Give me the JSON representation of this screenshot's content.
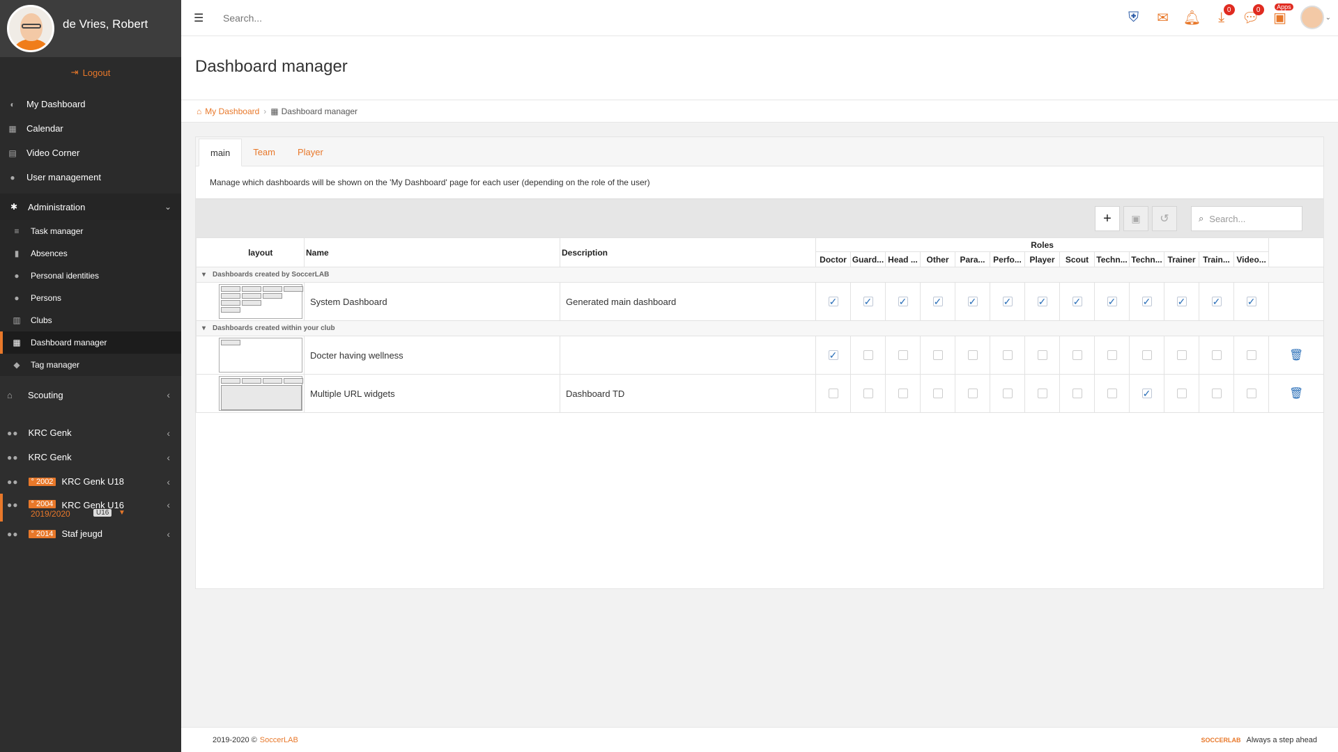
{
  "user": {
    "name": "de Vries, Robert",
    "logout": "Logout"
  },
  "nav_top": [
    {
      "label": "My Dashboard",
      "icon": "dashboard-icon"
    },
    {
      "label": "Calendar",
      "icon": "calendar-icon"
    },
    {
      "label": "Video Corner",
      "icon": "film-icon"
    },
    {
      "label": "User management",
      "icon": "user-icon"
    }
  ],
  "admin": {
    "label": "Administration",
    "items": [
      {
        "label": "Task manager"
      },
      {
        "label": "Absences"
      },
      {
        "label": "Personal identities"
      },
      {
        "label": "Persons"
      },
      {
        "label": "Clubs"
      },
      {
        "label": "Dashboard manager"
      },
      {
        "label": "Tag manager"
      }
    ]
  },
  "scouting": {
    "label": "Scouting"
  },
  "teams": [
    {
      "label": "KRC Genk",
      "year": ""
    },
    {
      "label": "KRC Genk",
      "year": ""
    },
    {
      "label": "KRC Genk U18",
      "year": "° 2002"
    },
    {
      "label": "KRC Genk U16",
      "year": "° 2004",
      "season": "2019/2020",
      "tag": "U16"
    },
    {
      "label": "Staf jeugd",
      "year": "° 2014"
    }
  ],
  "topbar": {
    "search_placeholder": "Search...",
    "downloads_count": "0",
    "chat_count": "0",
    "apps_label": "Apps"
  },
  "page": {
    "title": "Dashboard manager",
    "breadcrumb": {
      "home": "My Dashboard",
      "current": "Dashboard manager"
    }
  },
  "tabs": [
    "main",
    "Team",
    "Player"
  ],
  "description": "Manage which dashboards will be shown on the 'My Dashboard' page for each user (depending on the role of the user)",
  "grid": {
    "search_placeholder": "Search...",
    "headers": {
      "layout": "layout",
      "name": "Name",
      "description": "Description",
      "roles": "Roles"
    },
    "roles": [
      "Doctor",
      "Guard...",
      "Head ...",
      "Other",
      "Para...",
      "Perfo...",
      "Player",
      "Scout",
      "Techn...",
      "Techn...",
      "Trainer",
      "Train...",
      "Video..."
    ],
    "groups": [
      {
        "label": "Dashboards created by SoccerLAB",
        "rows": [
          {
            "name": "System Dashboard",
            "description": "Generated main dashboard",
            "roles": [
              1,
              1,
              1,
              1,
              1,
              1,
              1,
              1,
              1,
              1,
              1,
              1,
              1
            ],
            "deletable": false,
            "layout": "system"
          }
        ]
      },
      {
        "label": "Dashboards created within your club",
        "rows": [
          {
            "name": "Docter having wellness",
            "description": "",
            "roles": [
              1,
              0,
              0,
              0,
              0,
              0,
              0,
              0,
              0,
              0,
              0,
              0,
              0
            ],
            "deletable": true,
            "layout": "single"
          },
          {
            "name": "Multiple URL widgets",
            "description": "Dashboard TD",
            "roles": [
              0,
              0,
              0,
              0,
              0,
              0,
              0,
              0,
              0,
              1,
              0,
              0,
              0
            ],
            "deletable": true,
            "layout": "multi"
          }
        ]
      }
    ]
  },
  "footer": {
    "copyright": "2019-2020 ©",
    "brand": "SoccerLAB",
    "tagline": "Always a step ahead",
    "logo_text": "SOCCERLAB"
  },
  "colors": {
    "accent": "#e8782a",
    "sidebar": "#2e2e2e",
    "check": "#2a6fb8"
  }
}
